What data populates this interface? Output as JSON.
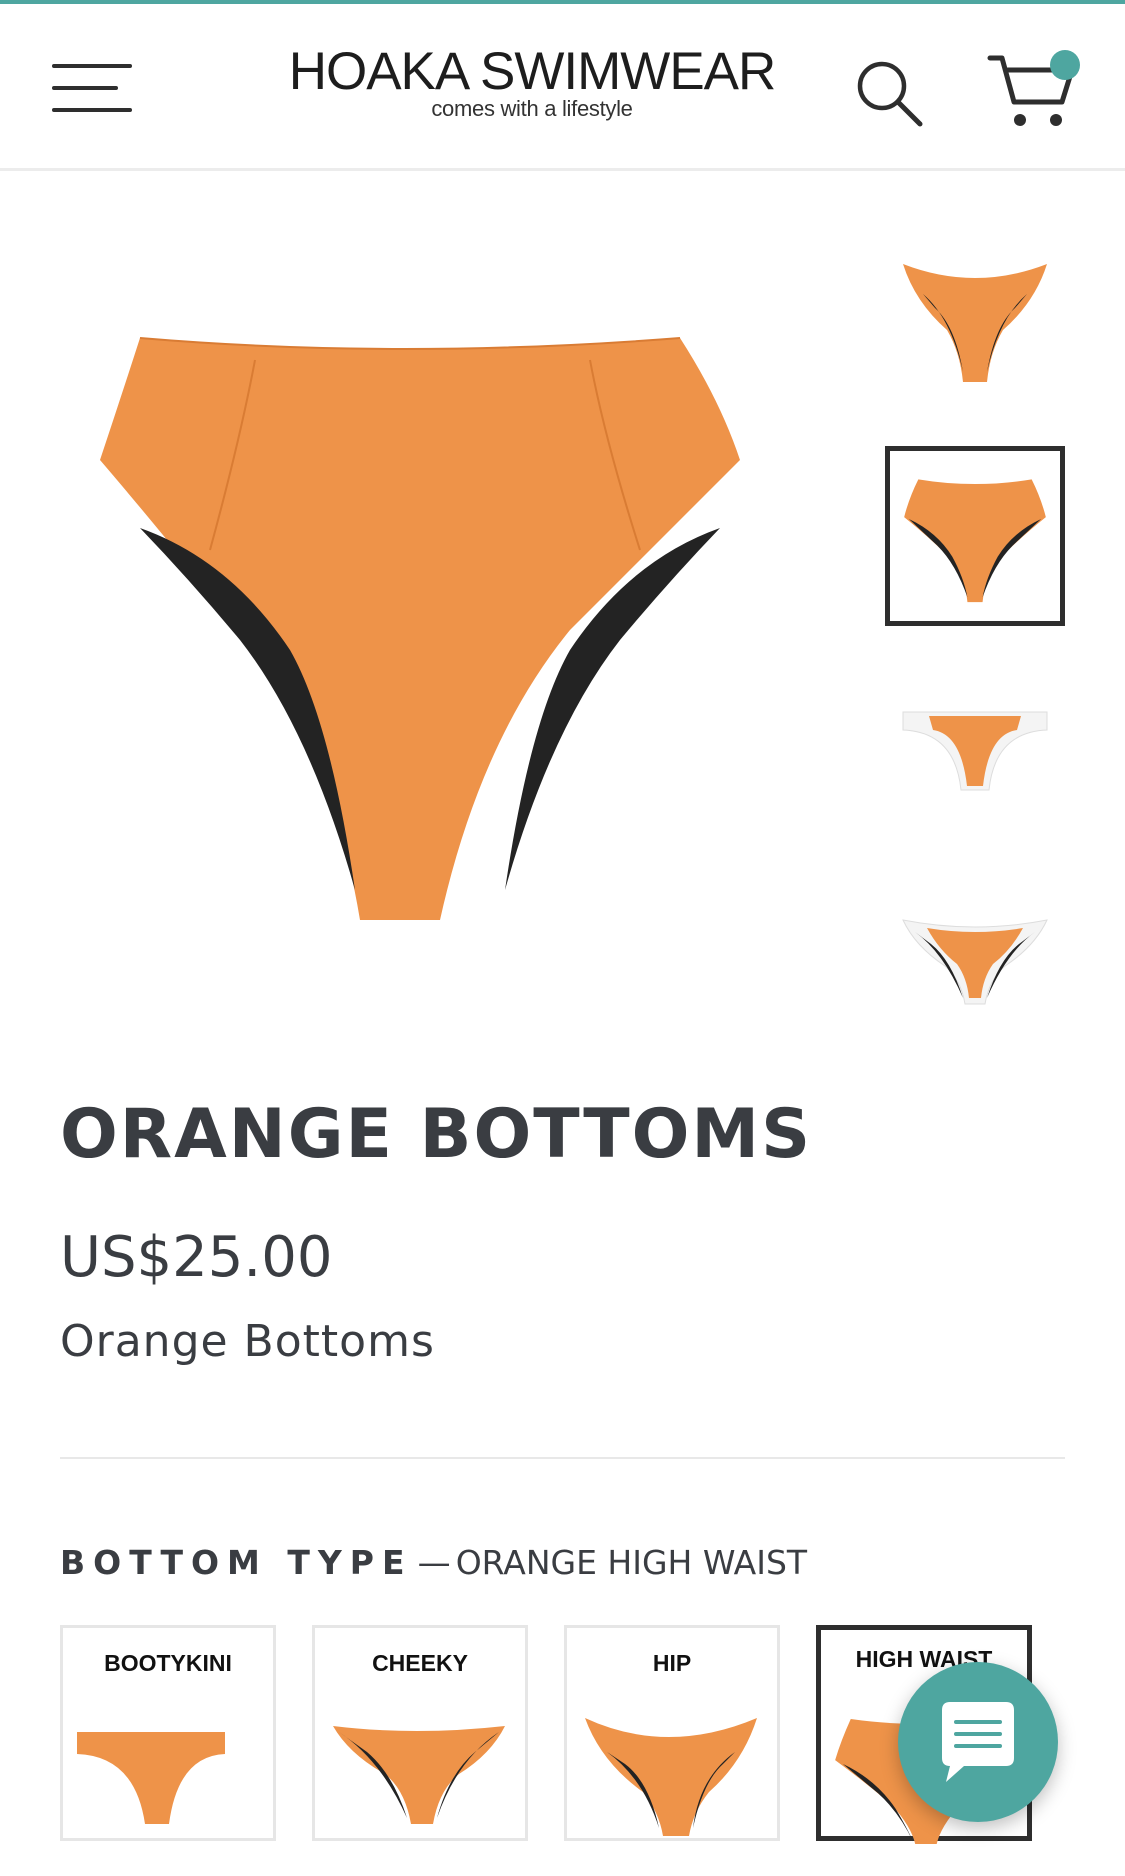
{
  "colors": {
    "accent": "#4ea6a0",
    "product_orange": "#ee9349",
    "lining_black": "#232323",
    "text": "#3a3d42"
  },
  "header": {
    "brand_title": "HOAKA SWIMWEAR",
    "brand_tagline": "comes with a lifestyle",
    "menu_icon": "hamburger-menu-icon",
    "search_icon": "search-icon",
    "cart_icon": "shopping-cart-icon",
    "cart_badge": "notification-dot"
  },
  "gallery": {
    "main_image": "orange-high-waist-bottom",
    "thumbnails": [
      {
        "name": "orange-hip-bottom",
        "selected": false
      },
      {
        "name": "orange-high-waist-bottom",
        "selected": true
      },
      {
        "name": "orange-bootykini-bottom",
        "selected": false
      },
      {
        "name": "orange-cheeky-bottom",
        "selected": false
      }
    ]
  },
  "product": {
    "title": "ORANGE BOTTOMS",
    "price": "US$25.00",
    "subtitle": "Orange Bottoms"
  },
  "options": {
    "name": "BOTTOM TYPE",
    "separator": "—",
    "selected_value": "ORANGE HIGH WAIST",
    "swatches": [
      {
        "label": "BOOTYKINI",
        "selected": false
      },
      {
        "label": "CHEEKY",
        "selected": false
      },
      {
        "label": "HIP",
        "selected": false
      },
      {
        "label": "HIGH WAIST",
        "selected": true
      }
    ]
  },
  "chat": {
    "icon": "chat-bubble-icon"
  }
}
